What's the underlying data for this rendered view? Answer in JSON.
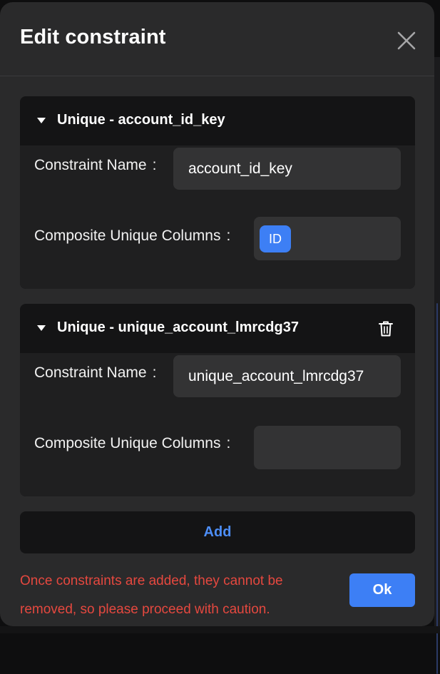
{
  "dialog": {
    "title": "Edit constraint",
    "close_icon": "close-icon"
  },
  "constraints": [
    {
      "title": "Unique - account_id_key",
      "name_label": "Constraint Name",
      "name_value": "account_id_key",
      "columns_label": "Composite Unique Columns",
      "columns": [
        "ID"
      ],
      "deletable": false
    },
    {
      "title": "Unique - unique_account_lmrcdg37",
      "name_label": "Constraint Name",
      "name_value": "unique_account_lmrcdg37",
      "columns_label": "Composite Unique Columns",
      "columns": [],
      "deletable": true
    }
  ],
  "colon": ":",
  "add_label": "Add",
  "warning_text": "Once constraints are added, they cannot be removed, so please proceed with caution.",
  "ok_label": "Ok",
  "colors": {
    "accent": "#3d7ff5",
    "link": "#4d8ef7",
    "warning": "#e5483f"
  }
}
